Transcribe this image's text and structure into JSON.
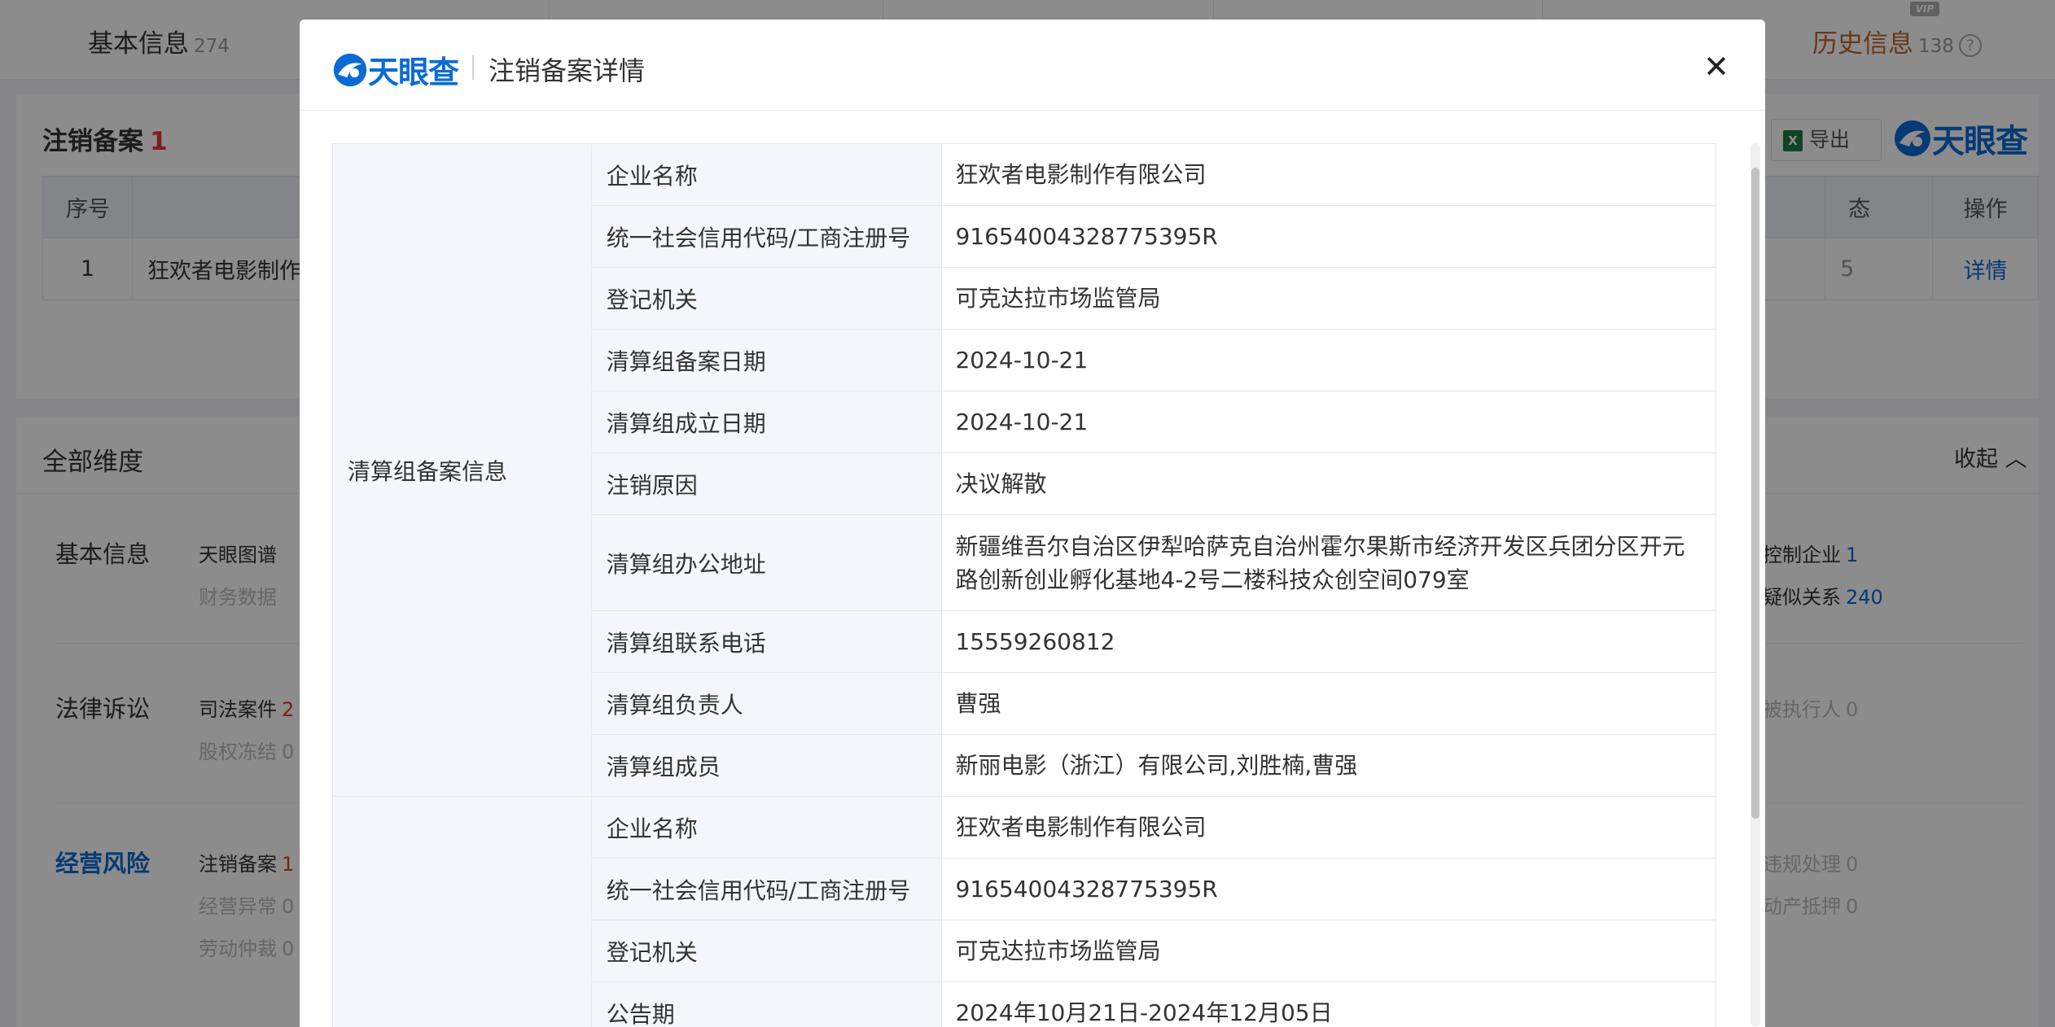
{
  "background": {
    "topbar": {
      "left_tab": "基本信息",
      "left_tab_count": "274",
      "right_tab": "历史信息",
      "right_tab_count": "138",
      "help": "?",
      "vip_badge": "VIP"
    },
    "record_card": {
      "title": "注销备案",
      "count": "1",
      "export_label": "导出",
      "logo": "天眼查",
      "headers": [
        "序号",
        "",
        "态",
        "操作"
      ],
      "rows": [
        {
          "index": "1",
          "company": "狂欢者电影制作",
          "status": "5",
          "action": "详情"
        }
      ]
    },
    "dimensions": {
      "title": "全部维度",
      "collapse_label": "收起",
      "groups": [
        {
          "category": "基本信息",
          "items": [
            {
              "label": "天眼图谱",
              "count": ""
            },
            {
              "label": "财务数据",
              "count": ""
            },
            {
              "label": "控制企业",
              "count": "1"
            },
            {
              "label": "疑似关系",
              "count": "240"
            }
          ]
        },
        {
          "category": "法律诉讼",
          "items": [
            {
              "label": "司法案件",
              "count": "2"
            },
            {
              "label": "股权冻结",
              "count": "0"
            },
            {
              "label": "被执行人",
              "count": "0"
            }
          ]
        },
        {
          "category": "经营风险",
          "items": [
            {
              "label": "注销备案",
              "count": "1"
            },
            {
              "label": "经营异常",
              "count": "0"
            },
            {
              "label": "劳动仲裁",
              "count": "0"
            },
            {
              "label": "违规处理",
              "count": "0"
            },
            {
              "label": "动产抵押",
              "count": "0"
            }
          ]
        }
      ]
    }
  },
  "modal": {
    "logo": "天眼查",
    "title": "注销备案详情",
    "close": "✕",
    "sections": [
      {
        "group": "清算组备案信息",
        "rows": [
          {
            "label": "企业名称",
            "value": "狂欢者电影制作有限公司"
          },
          {
            "label": "统一社会信用代码/工商注册号",
            "value": "91654004328775395R"
          },
          {
            "label": "登记机关",
            "value": "可克达拉市场监管局"
          },
          {
            "label": "清算组备案日期",
            "value": "2024-10-21"
          },
          {
            "label": "清算组成立日期",
            "value": "2024-10-21"
          },
          {
            "label": "注销原因",
            "value": "决议解散"
          },
          {
            "label": "清算组办公地址",
            "value": "新疆维吾尔自治区伊犁哈萨克自治州霍尔果斯市经济开发区兵团分区开元路创新创业孵化基地4-2号二楼科技众创空间079室"
          },
          {
            "label": "清算组联系电话",
            "value": "15559260812"
          },
          {
            "label": "清算组负责人",
            "value": "曹强"
          },
          {
            "label": "清算组成员",
            "value": "新丽电影（浙江）有限公司,刘胜楠,曹强"
          }
        ]
      },
      {
        "group": "",
        "rows": [
          {
            "label": "企业名称",
            "value": "狂欢者电影制作有限公司"
          },
          {
            "label": "统一社会信用代码/工商注册号",
            "value": "91654004328775395R"
          },
          {
            "label": "登记机关",
            "value": "可克达拉市场监管局"
          },
          {
            "label": "公告期",
            "value": "2024年10月21日-2024年12月05日"
          }
        ]
      }
    ]
  },
  "colors": {
    "brand_blue": "#0b6bd6",
    "danger_red": "#e53935",
    "history_orange": "#c0662b",
    "label_bg": "#f3f7fb",
    "overlay": "rgba(0,0,0,0.45)"
  }
}
